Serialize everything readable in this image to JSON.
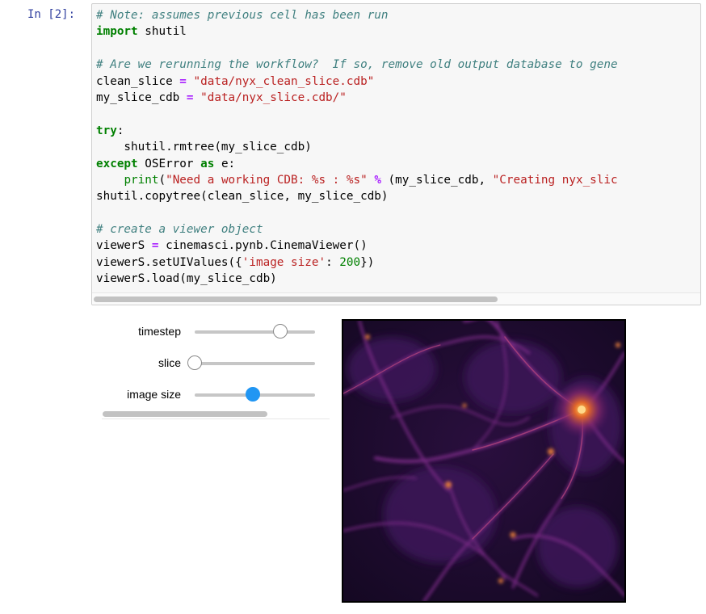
{
  "prompt": "In [2]:",
  "code_lines": [
    [
      {
        "t": "# Note: assumes previous cell has been run",
        "c": "cm"
      }
    ],
    [
      {
        "t": "import",
        "c": "kw"
      },
      {
        "t": " shutil",
        "c": ""
      }
    ],
    [],
    [
      {
        "t": "# Are we rerunning the workflow?  If so, remove old output database to gene",
        "c": "cm"
      }
    ],
    [
      {
        "t": "clean_slice ",
        "c": ""
      },
      {
        "t": "=",
        "c": "op"
      },
      {
        "t": " ",
        "c": ""
      },
      {
        "t": "\"data/nyx_clean_slice.cdb\"",
        "c": "st"
      }
    ],
    [
      {
        "t": "my_slice_cdb ",
        "c": ""
      },
      {
        "t": "=",
        "c": "op"
      },
      {
        "t": " ",
        "c": ""
      },
      {
        "t": "\"data/nyx_slice.cdb/\"",
        "c": "st"
      }
    ],
    [],
    [
      {
        "t": "try",
        "c": "kw"
      },
      {
        "t": ":",
        "c": ""
      }
    ],
    [
      {
        "t": "    shutil.rmtree(my_slice_cdb)",
        "c": ""
      }
    ],
    [
      {
        "t": "except",
        "c": "kw"
      },
      {
        "t": " OSError ",
        "c": ""
      },
      {
        "t": "as",
        "c": "kw"
      },
      {
        "t": " e:",
        "c": ""
      }
    ],
    [
      {
        "t": "    ",
        "c": ""
      },
      {
        "t": "print",
        "c": "nb"
      },
      {
        "t": "(",
        "c": ""
      },
      {
        "t": "\"Need a working CDB: %s : %s\"",
        "c": "st"
      },
      {
        "t": " ",
        "c": ""
      },
      {
        "t": "%",
        "c": "op"
      },
      {
        "t": " (my_slice_cdb, ",
        "c": ""
      },
      {
        "t": "\"Creating nyx_slic",
        "c": "st"
      }
    ],
    [
      {
        "t": "shutil.copytree(clean_slice, my_slice_cdb)",
        "c": ""
      }
    ],
    [],
    [
      {
        "t": "# create a viewer object",
        "c": "cm"
      }
    ],
    [
      {
        "t": "viewerS ",
        "c": ""
      },
      {
        "t": "=",
        "c": "op"
      },
      {
        "t": " cinemasci.pynb.CinemaViewer()",
        "c": ""
      }
    ],
    [
      {
        "t": "viewerS.setUIValues({",
        "c": ""
      },
      {
        "t": "'image size'",
        "c": "st"
      },
      {
        "t": ": ",
        "c": ""
      },
      {
        "t": "200",
        "c": "num"
      },
      {
        "t": "})",
        "c": ""
      }
    ],
    [
      {
        "t": "viewerS.load(my_slice_cdb)",
        "c": ""
      }
    ]
  ],
  "widgets": {
    "sliders": [
      {
        "label": "timestep",
        "value": 0.71,
        "active": false
      },
      {
        "label": "slice",
        "value": 0.0,
        "active": false
      },
      {
        "label": "image size",
        "value": 0.48,
        "active": true
      }
    ]
  },
  "colors": {
    "prompt": "#303f9f",
    "comment": "#408080",
    "keyword": "#008000",
    "string": "#ba2121",
    "operator": "#aa22ff",
    "slider_active": "#2196f3"
  },
  "viewer": {
    "image_name": "nyx-density-slice-image"
  }
}
